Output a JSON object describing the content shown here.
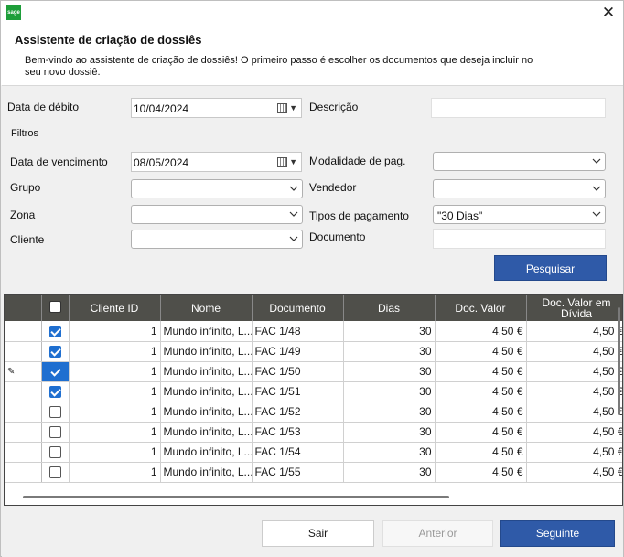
{
  "window": {
    "logo_text": "sage",
    "close_glyph": "✕"
  },
  "header": {
    "title": "Assistente de criação de dossiês",
    "description": "Bem-vindo ao assistente de criação de dossiês! O primeiro passo é escolher os documentos que deseja incluir no seu novo dossiê."
  },
  "form": {
    "debit_date_label": "Data de débito",
    "debit_date_value": "10/04/2024",
    "description_label": "Descrição",
    "description_value": "",
    "filters_label": "Filtros",
    "due_date_label": "Data de vencimento",
    "due_date_value": "08/05/2024",
    "payment_mode_label": "Modalidade de pag.",
    "payment_mode_value": "",
    "group_label": "Grupo",
    "group_value": "",
    "seller_label": "Vendedor",
    "seller_value": "",
    "zone_label": "Zona",
    "zone_value": "",
    "payment_types_label": "Tipos de pagamento",
    "payment_types_value": "\"30 Dias\"",
    "client_label": "Cliente",
    "client_value": "",
    "document_label": "Documento",
    "document_value": "",
    "search_button": "Pesquisar"
  },
  "grid": {
    "columns": [
      "Cliente ID",
      "Nome",
      "Documento",
      "Dias",
      "Doc. Valor",
      "Doc. Valor em Dívida"
    ],
    "rows": [
      {
        "checked": true,
        "edit": false,
        "client_id": "1",
        "name": "Mundo infinito, L...",
        "document": "FAC 1/48",
        "days": "30",
        "value": "4,50 €",
        "debt": "4,50 €"
      },
      {
        "checked": true,
        "edit": false,
        "client_id": "1",
        "name": "Mundo infinito, L...",
        "document": "FAC 1/49",
        "days": "30",
        "value": "4,50 €",
        "debt": "4,50 €"
      },
      {
        "checked": true,
        "edit": true,
        "client_id": "1",
        "name": "Mundo infinito, L...",
        "document": "FAC 1/50",
        "days": "30",
        "value": "4,50 €",
        "debt": "4,50 €"
      },
      {
        "checked": true,
        "edit": false,
        "client_id": "1",
        "name": "Mundo infinito, L...",
        "document": "FAC 1/51",
        "days": "30",
        "value": "4,50 €",
        "debt": "4,50 €"
      },
      {
        "checked": false,
        "edit": false,
        "client_id": "1",
        "name": "Mundo infinito, L...",
        "document": "FAC 1/52",
        "days": "30",
        "value": "4,50 €",
        "debt": "4,50 €"
      },
      {
        "checked": false,
        "edit": false,
        "client_id": "1",
        "name": "Mundo infinito, L...",
        "document": "FAC 1/53",
        "days": "30",
        "value": "4,50 €",
        "debt": "4,50 €"
      },
      {
        "checked": false,
        "edit": false,
        "client_id": "1",
        "name": "Mundo infinito, L...",
        "document": "FAC 1/54",
        "days": "30",
        "value": "4,50 €",
        "debt": "4,50 €"
      },
      {
        "checked": false,
        "edit": false,
        "client_id": "1",
        "name": "Mundo infinito, L...",
        "document": "FAC 1/55",
        "days": "30",
        "value": "4,50 €",
        "debt": "4,50 €"
      }
    ]
  },
  "footer": {
    "exit": "Sair",
    "previous": "Anterior",
    "next": "Seguinte"
  },
  "colors": {
    "accent": "#2f5aa8",
    "grid_header": "#4f4f4a",
    "checkbox": "#1f6fd0"
  }
}
